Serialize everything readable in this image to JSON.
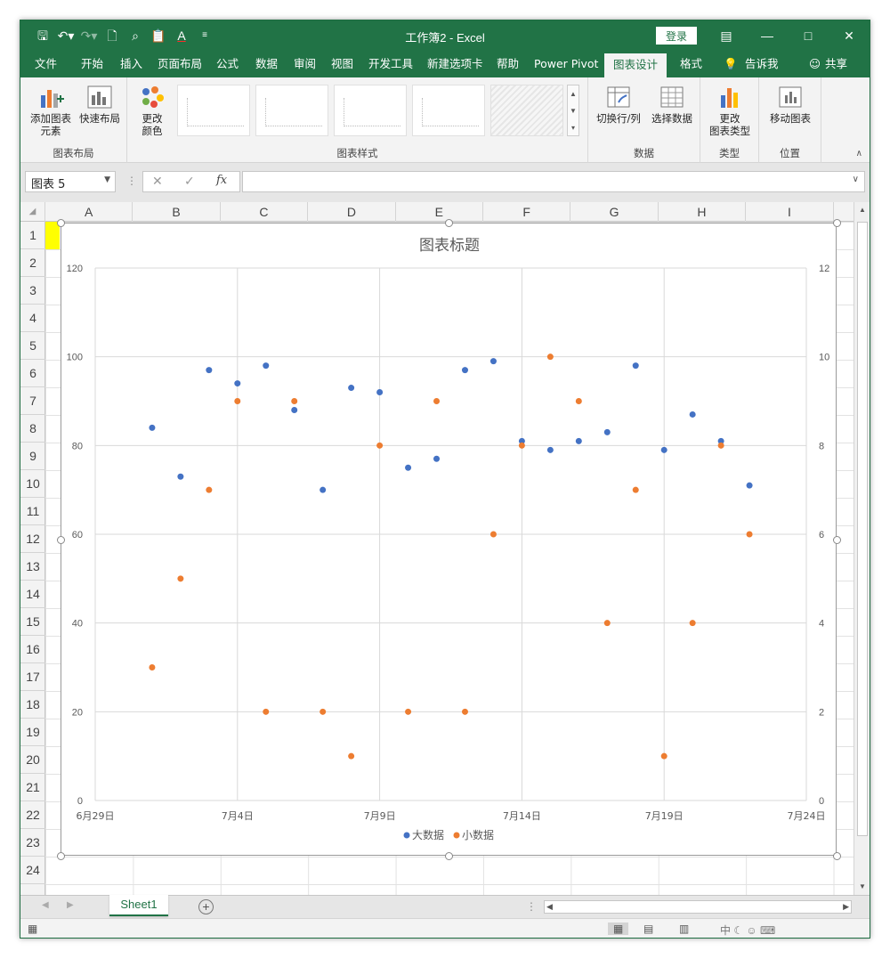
{
  "window": {
    "title": "工作簿2  -  Excel",
    "login_label": "登录"
  },
  "tabs": [
    {
      "label": "文件"
    },
    {
      "label": "开始"
    },
    {
      "label": "插入"
    },
    {
      "label": "页面布局"
    },
    {
      "label": "公式"
    },
    {
      "label": "数据"
    },
    {
      "label": "审阅"
    },
    {
      "label": "视图"
    },
    {
      "label": "开发工具"
    },
    {
      "label": "新建选项卡"
    },
    {
      "label": "帮助"
    },
    {
      "label": "Power Pivot"
    },
    {
      "label": "图表设计",
      "active": true
    },
    {
      "label": "格式"
    }
  ],
  "tell_me": "告诉我",
  "share": "共享",
  "ribbon": {
    "add_element": "添加图表\n元素",
    "quick_layout": "快速布局",
    "group_layout": "图表布局",
    "change_color": "更改\n颜色",
    "group_styles": "图表样式",
    "switch_row_col": "切换行/列",
    "select_data": "选择数据",
    "group_data": "数据",
    "change_type": "更改\n图表类型",
    "group_type": "类型",
    "move_chart": "移动图表",
    "group_location": "位置"
  },
  "formula_bar": {
    "name_box": "图表 5",
    "fx": "fx"
  },
  "columns": [
    "A",
    "B",
    "C",
    "D",
    "E",
    "F",
    "G",
    "H",
    "I"
  ],
  "rows": [
    "1",
    "2",
    "3",
    "4",
    "5",
    "6",
    "7",
    "8",
    "9",
    "10",
    "11",
    "12",
    "13",
    "14",
    "15",
    "16",
    "17",
    "18",
    "19",
    "20",
    "21",
    "22",
    "23",
    "24"
  ],
  "sheet": {
    "tab": "Sheet1"
  },
  "colors": {
    "excel_green": "#217346",
    "series1": "#4472c4",
    "series2": "#ed7d31"
  },
  "chart_data": {
    "type": "scatter",
    "title": "图表标题",
    "x_tick_labels": [
      "6月29日",
      "7月4日",
      "7月9日",
      "7月14日",
      "7月19日",
      "7月24日"
    ],
    "x_ticks": [
      "2019-06-29",
      "2019-07-04",
      "2019-07-09",
      "2019-07-14",
      "2019-07-19",
      "2019-07-24"
    ],
    "xlim": [
      "2019-06-29",
      "2019-07-24"
    ],
    "y_left_ticks": [
      0,
      20,
      40,
      60,
      80,
      100,
      120
    ],
    "y_left_lim": [
      0,
      120
    ],
    "y_right_ticks": [
      0,
      2,
      4,
      6,
      8,
      10,
      12
    ],
    "y_right_lim": [
      0,
      12
    ],
    "grid": true,
    "legend": "bottom",
    "x": [
      "2019-07-01",
      "2019-07-02",
      "2019-07-03",
      "2019-07-04",
      "2019-07-05",
      "2019-07-06",
      "2019-07-07",
      "2019-07-08",
      "2019-07-09",
      "2019-07-10",
      "2019-07-11",
      "2019-07-12",
      "2019-07-13",
      "2019-07-14",
      "2019-07-15",
      "2019-07-16",
      "2019-07-17",
      "2019-07-18",
      "2019-07-19",
      "2019-07-20",
      "2019-07-21",
      "2019-07-22"
    ],
    "series": [
      {
        "name": "大数据",
        "axis": "left",
        "color": "#4472c4",
        "values": [
          84,
          73,
          97,
          94,
          98,
          88,
          70,
          93,
          92,
          75,
          77,
          97,
          99,
          81,
          79,
          81,
          83,
          98,
          79,
          87,
          81,
          71
        ]
      },
      {
        "name": "小数据",
        "axis": "right",
        "color": "#ed7d31",
        "values": [
          3,
          5,
          7,
          9,
          2,
          9,
          2,
          1,
          8,
          2,
          9,
          2,
          6,
          8,
          10,
          9,
          4,
          7,
          1,
          4,
          8,
          6
        ]
      }
    ]
  }
}
